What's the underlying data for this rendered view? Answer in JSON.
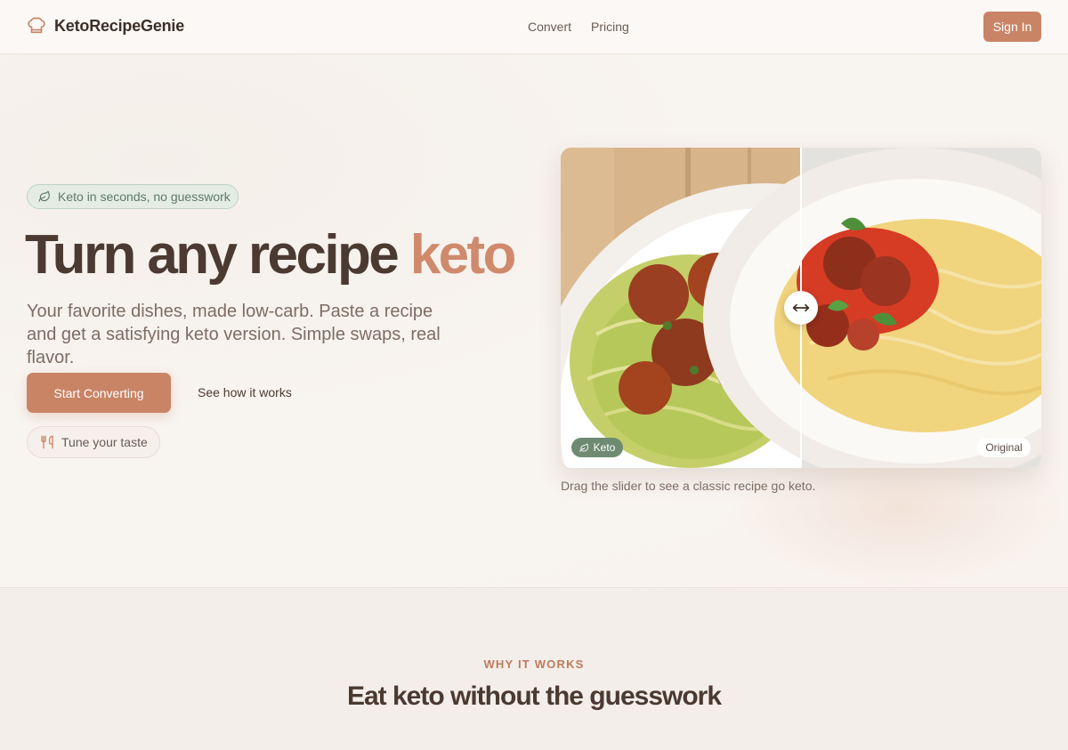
{
  "nav": {
    "brand": "KetoRecipeGenie",
    "links": [
      "Convert",
      "Pricing"
    ],
    "signin": "Sign In"
  },
  "hero": {
    "badge": "Keto in seconds, no guesswork",
    "headline_main": "Turn any recipe ",
    "headline_accent": "keto",
    "subtext": "Your favorite dishes, made low-carb. Paste a recipe and get a satisfying keto version. Simple swaps, real flavor.",
    "primary_cta": "Start Converting",
    "secondary_cta": "See how it works",
    "pill_cta": "Tune your taste"
  },
  "compare": {
    "left_tag": "Keto",
    "right_tag": "Original",
    "slider_position": 0.5,
    "caption": "Drag the slider to see a classic recipe go keto."
  },
  "section": {
    "eyebrow": "WHY IT WORKS",
    "title": "Eat keto without the guesswork"
  },
  "colors": {
    "accent": "#c98466",
    "green": "#6e8b72",
    "text": "#4b3a31"
  }
}
